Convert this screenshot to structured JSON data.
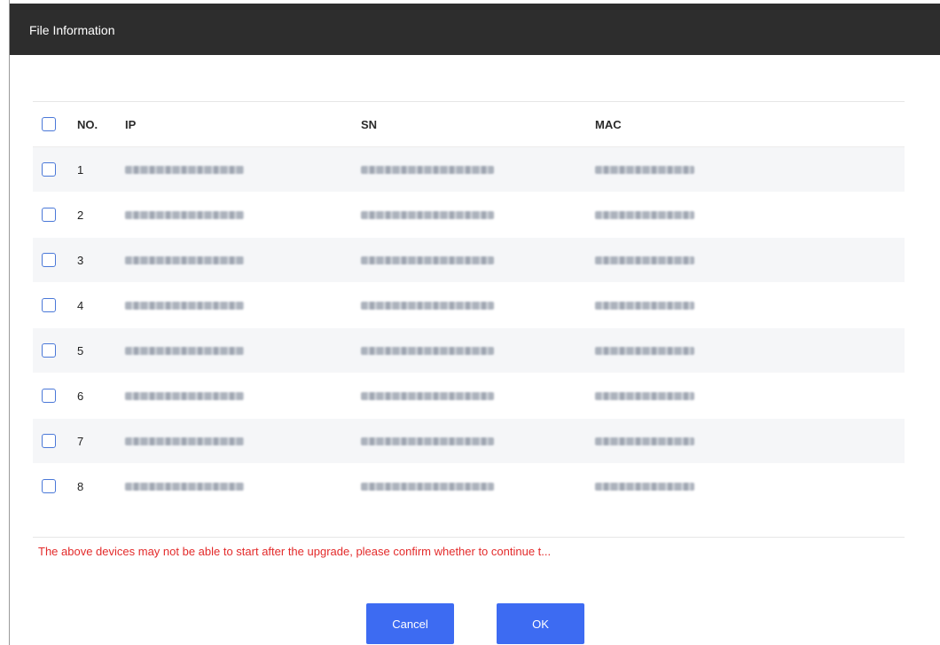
{
  "dialog": {
    "title": "File Information"
  },
  "table": {
    "headers": {
      "no": "NO.",
      "ip": "IP",
      "sn": "SN",
      "mac": "MAC"
    },
    "rows": [
      {
        "no": "1"
      },
      {
        "no": "2"
      },
      {
        "no": "3"
      },
      {
        "no": "4"
      },
      {
        "no": "5"
      },
      {
        "no": "6"
      },
      {
        "no": "7"
      },
      {
        "no": "8"
      }
    ]
  },
  "warning": "The above devices may not be able to start after the upgrade, please confirm whether to continue t...",
  "buttons": {
    "cancel": "Cancel",
    "ok": "OK"
  },
  "colors": {
    "title_bar": "#2d2d2d",
    "accent": "#3d6bf2",
    "warning": "#e32b2b"
  }
}
